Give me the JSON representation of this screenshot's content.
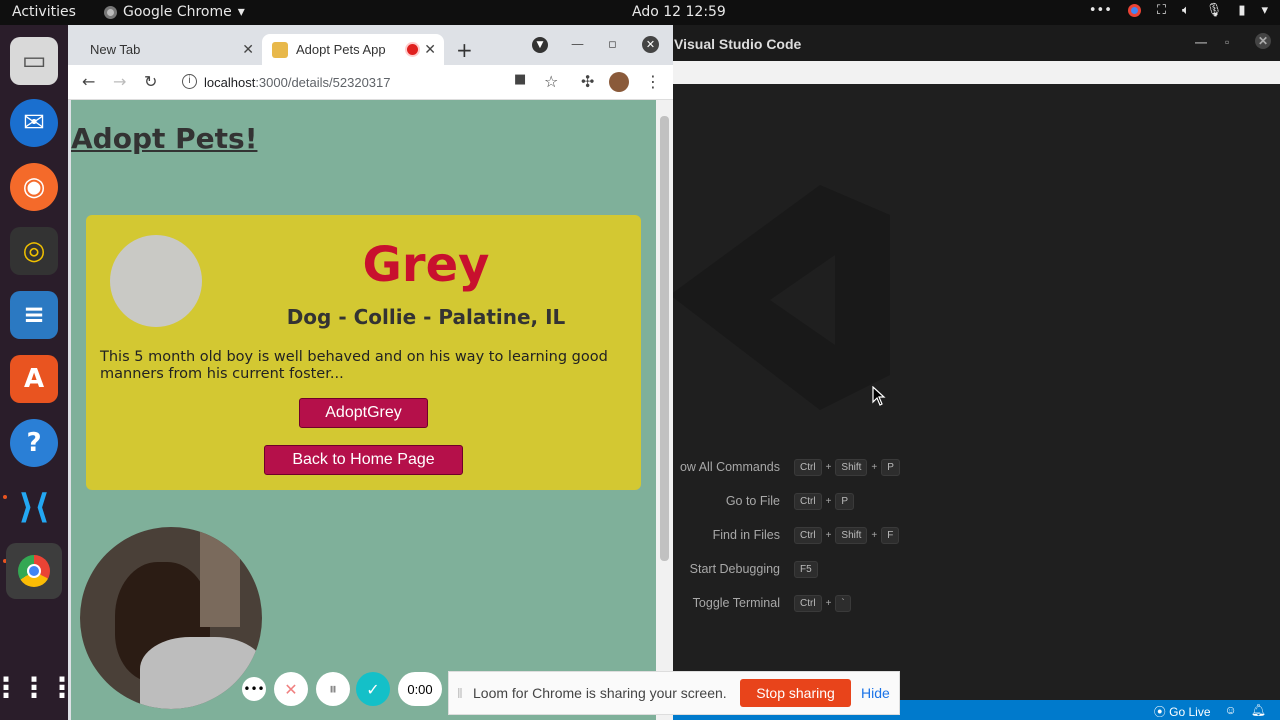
{
  "topbar": {
    "activities": "Activities",
    "app_name": "Google Chrome",
    "clock": "Ado 12  12:59"
  },
  "chrome": {
    "tabs": [
      {
        "label": "New Tab"
      },
      {
        "label": "Adopt Pets App"
      }
    ],
    "url_host": "localhost",
    "url_path": ":3000/details/52320317"
  },
  "page": {
    "site_title": "Adopt Pets!",
    "pet_name": "Grey",
    "pet_subtitle": "Dog - Collie - Palatine, IL",
    "description": "This 5 month old boy is well behaved and on his way to learning good manners from his current foster...",
    "adopt_button": "AdoptGrey",
    "home_button": "Back to Home Page"
  },
  "vscode": {
    "title": "Visual Studio Code",
    "commands": [
      {
        "label": "ow All Commands",
        "keys": [
          "Ctrl",
          "+",
          "Shift",
          "+",
          "P"
        ]
      },
      {
        "label": "Go to File",
        "keys": [
          "Ctrl",
          "+",
          "P"
        ]
      },
      {
        "label": "Find in Files",
        "keys": [
          "Ctrl",
          "+",
          "Shift",
          "+",
          "F"
        ]
      },
      {
        "label": "Start Debugging",
        "keys": [
          "F5"
        ]
      },
      {
        "label": "Toggle Terminal",
        "keys": [
          "Ctrl",
          "+",
          "`"
        ]
      }
    ],
    "status_go_live": "Go Live"
  },
  "loom": {
    "timer": "0:00",
    "message": "Loom for Chrome is sharing your screen.",
    "stop_label": "Stop sharing",
    "hide_label": "Hide"
  },
  "colors": {
    "page_bg": "#7fb09a",
    "card_bg": "#d3c832",
    "accent_red": "#c8102e",
    "button_bg": "#b5104a",
    "loom_stop": "#e8441b",
    "vscode_status": "#007acc"
  }
}
